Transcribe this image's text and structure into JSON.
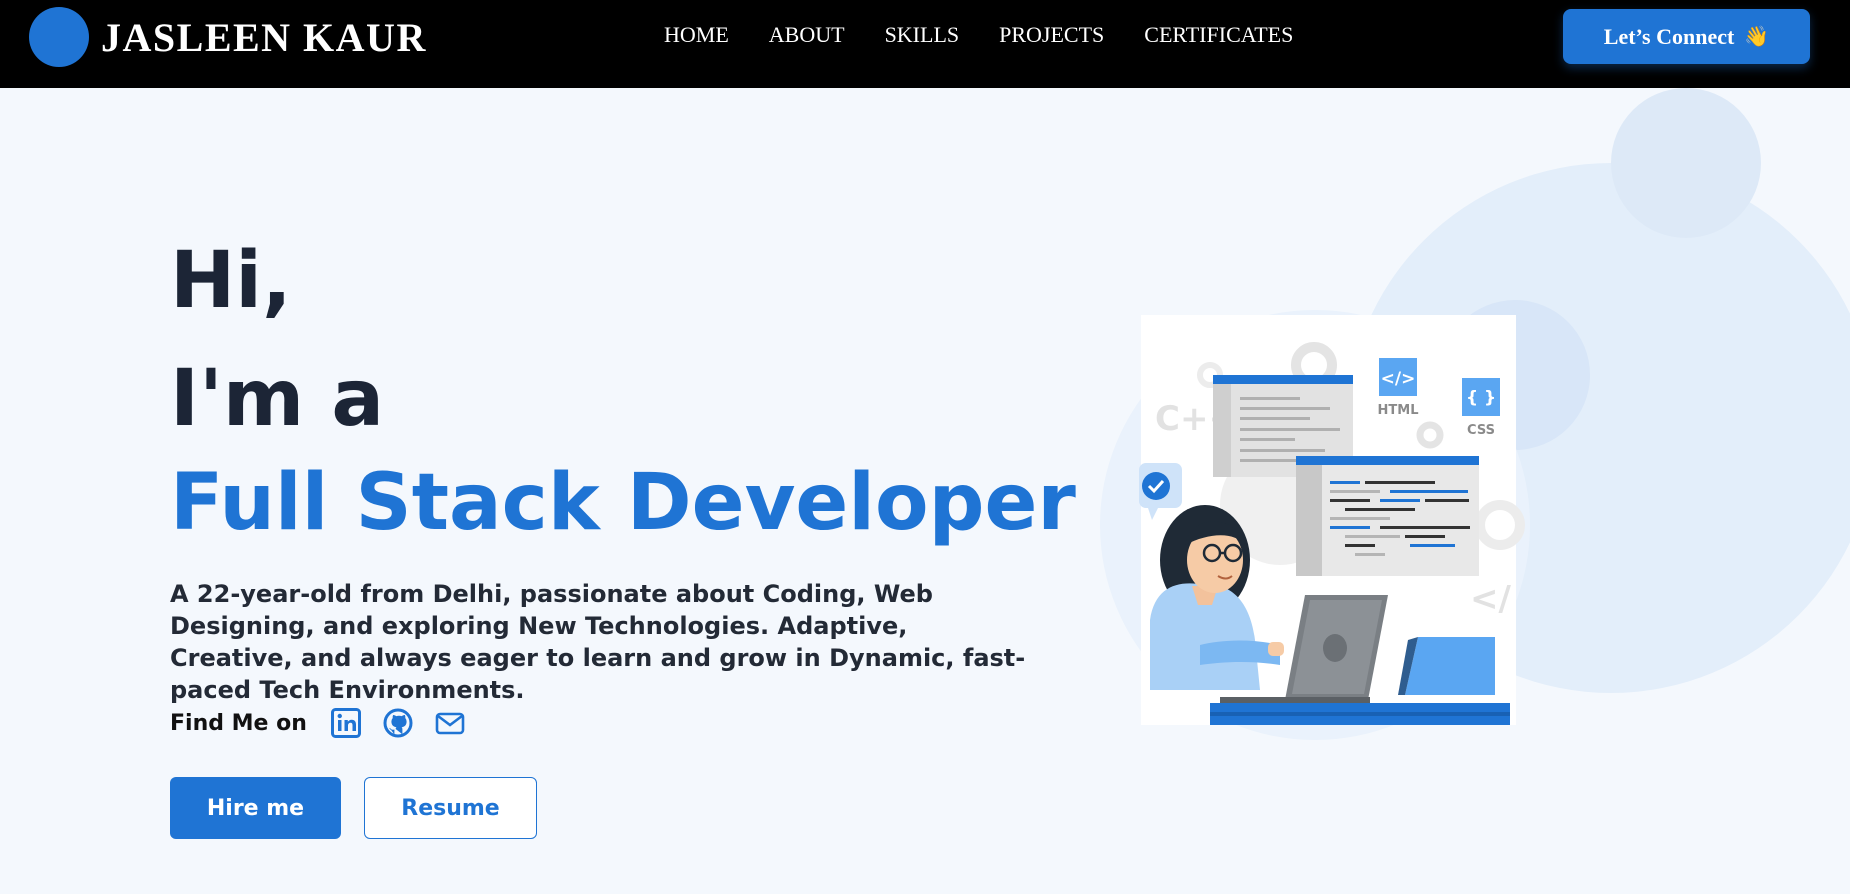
{
  "nav": {
    "brand": "JASLEEN KAUR",
    "links": [
      "HOME",
      "ABOUT",
      "SKILLS",
      "PROJECTS",
      "CERTIFICATES"
    ],
    "connect_label": "Let’s Connect",
    "connect_emoji": "👋"
  },
  "hero": {
    "line1": "Hi,",
    "line2": "I'm a",
    "role": "Full Stack Developer",
    "intro": "A 22-year-old from Delhi, passionate about Coding, Web Designing, and exploring New Technologies. Adaptive, Creative, and always eager to learn and grow in Dynamic, fast-paced Tech Environments.",
    "find_label": "Find Me on",
    "socials": [
      "linkedin-icon",
      "github-icon",
      "mail-icon"
    ],
    "hire_label": "Hire me",
    "resume_label": "Resume"
  },
  "illustration": {
    "html_label": "HTML",
    "css_label": "CSS",
    "cpp_label": "C++"
  },
  "colors": {
    "accent": "#1f74d4",
    "navbar": "#000000",
    "background": "#f4f8fd",
    "heading": "#1c2536"
  }
}
